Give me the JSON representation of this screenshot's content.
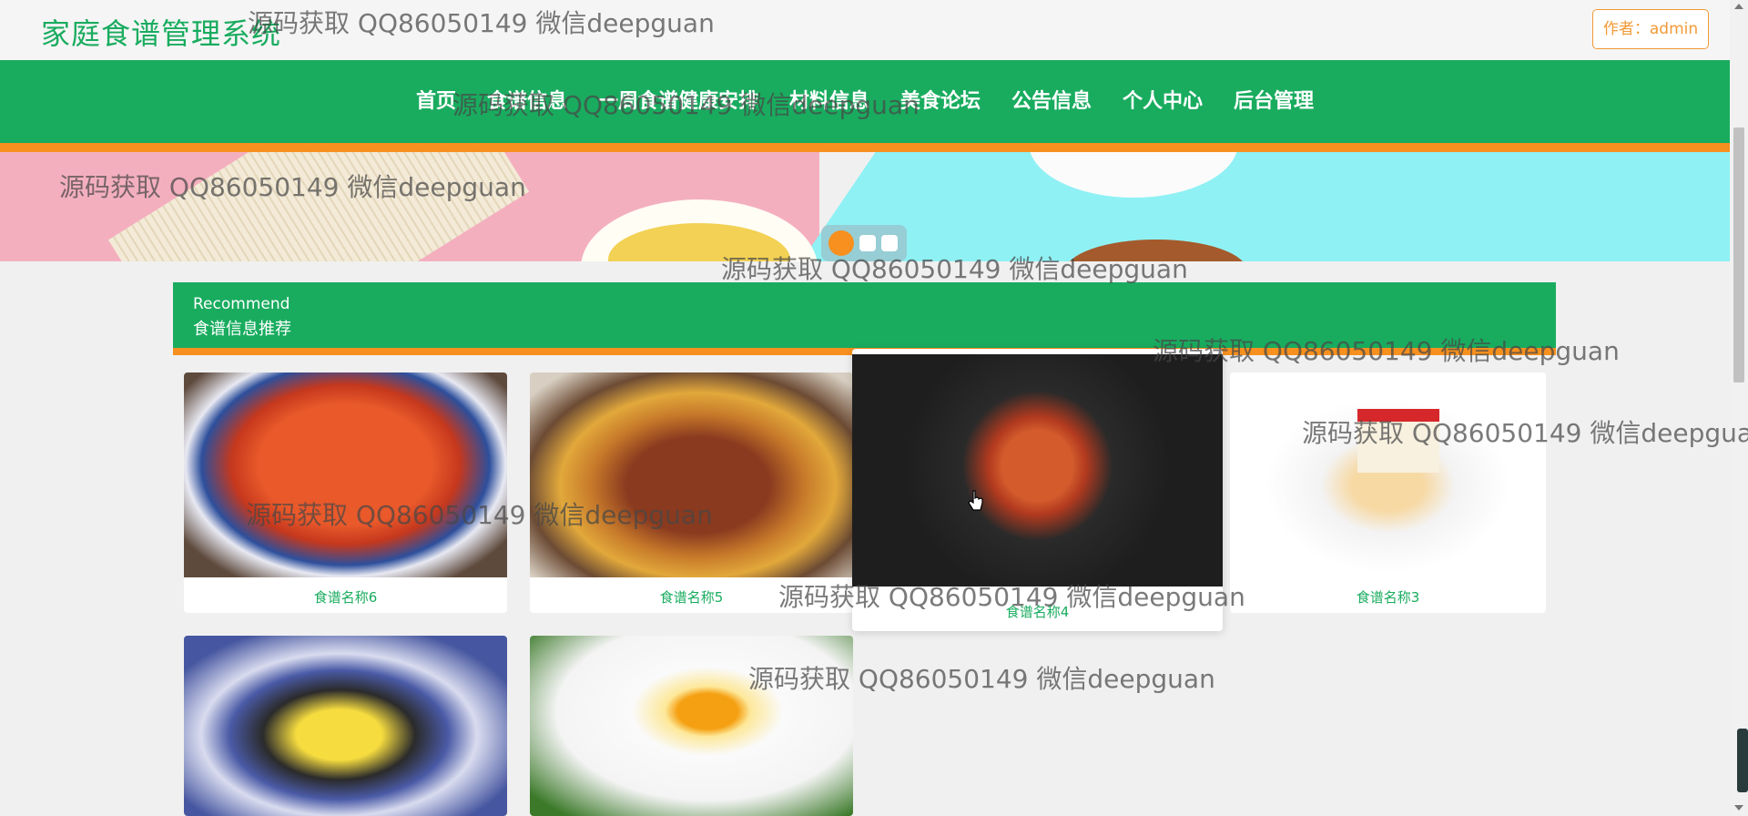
{
  "header": {
    "site_title": "家庭食谱管理系统",
    "author_button": "作者：admin"
  },
  "nav": {
    "items": [
      "首页",
      "食谱信息",
      "一周食谱健康安排",
      "材料信息",
      "美食论坛",
      "公告信息",
      "个人中心",
      "后台管理"
    ]
  },
  "carousel": {
    "dots": 3,
    "active_index": 0
  },
  "recommend": {
    "subtitle_en": "Recommend",
    "title": "食谱信息推荐",
    "cards": [
      {
        "name": "食谱名称6",
        "image": "crawfish-photo"
      },
      {
        "name": "食谱名称5",
        "image": "braised-dish-photo"
      },
      {
        "name": "食谱名称4",
        "image": "dark-plate-photo"
      },
      {
        "name": "食谱名称3",
        "image": "strawberry-cake-photo"
      },
      {
        "name": "",
        "image": "mango-dessert-photo"
      },
      {
        "name": "",
        "image": "fried-egg-photo"
      }
    ]
  },
  "watermark": {
    "text": "源码获取 QQ86050149 微信deepguan"
  },
  "colors": {
    "primary_green": "#19ac5f",
    "accent_orange": "#f7901e"
  }
}
